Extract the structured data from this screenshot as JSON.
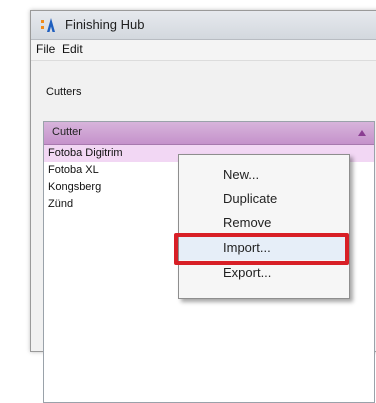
{
  "window": {
    "title": "Finishing Hub",
    "logo": "app-logo-icon"
  },
  "menubar": {
    "items": [
      "File",
      "Edit"
    ]
  },
  "cutters": {
    "label": "Cutters",
    "header": "Cutter",
    "rows": [
      "Fotoba Digitrim",
      "Fotoba XL",
      "Kongsberg",
      "Zünd"
    ],
    "selected_index": 0
  },
  "context_menu": {
    "items": [
      "New...",
      "Duplicate",
      "Remove",
      "Import...",
      "Export..."
    ],
    "highlighted": "Import..."
  },
  "colors": {
    "header": "#c592cb",
    "selection": "#f2d7f4",
    "highlight_border": "#d81f26",
    "logo_blue": "#1f5fbf",
    "logo_orange": "#f08a18"
  }
}
